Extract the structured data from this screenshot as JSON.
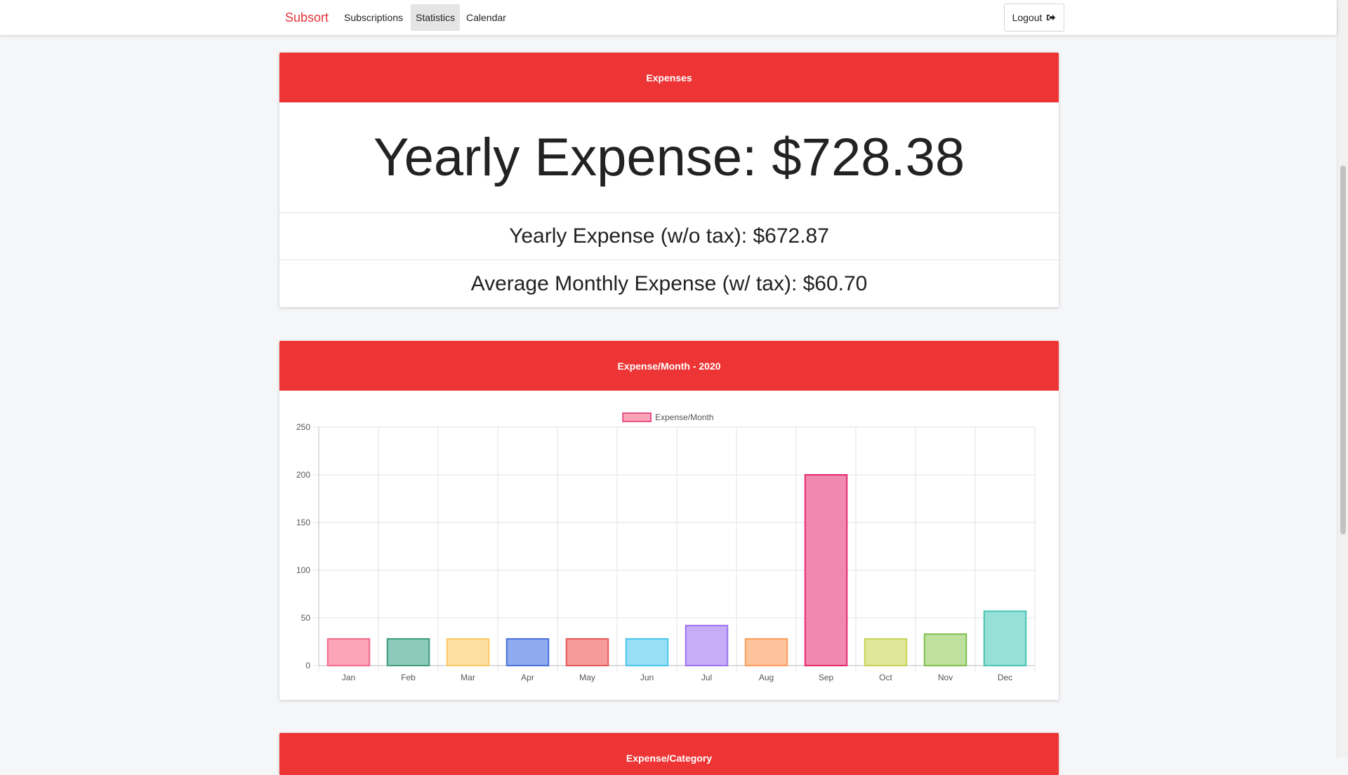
{
  "navbar": {
    "brand": "Subsort",
    "items": [
      {
        "label": "Subscriptions",
        "active": false
      },
      {
        "label": "Statistics",
        "active": true
      },
      {
        "label": "Calendar",
        "active": false
      }
    ],
    "logout_label": "Logout",
    "logout_icon": "sign-out-icon"
  },
  "expenses_card": {
    "header": "Expenses",
    "yearly": "Yearly Expense: $728.38",
    "yearly_no_tax": "Yearly Expense (w/o tax): $672.87",
    "avg_monthly": "Average Monthly Expense (w/ tax): $60.70"
  },
  "chart_card": {
    "header": "Expense/Month - 2020"
  },
  "category_card": {
    "header": "Expense/Category"
  },
  "colors": {
    "accent": "#ee3535",
    "brand": "#e9353a"
  },
  "chart_data": {
    "type": "bar",
    "categories": [
      "Jan",
      "Feb",
      "Mar",
      "Apr",
      "May",
      "Jun",
      "Jul",
      "Aug",
      "Sep",
      "Oct",
      "Nov",
      "Dec"
    ],
    "series": [
      {
        "name": "Expense/Month",
        "values": [
          28,
          28,
          28,
          28,
          28,
          28,
          42,
          28,
          200,
          28,
          33,
          57
        ]
      }
    ],
    "ylim": [
      0,
      250
    ],
    "yticks": [
      0,
      50,
      100,
      150,
      200,
      250
    ],
    "grid": true,
    "legend": "top-center",
    "bar_fills": [
      "#fda4b8",
      "#8ecaba",
      "#fddfa2",
      "#8fabf0",
      "#f69a9a",
      "#96dff5",
      "#c5adf8",
      "#fdc49c",
      "#f189ae",
      "#e1e799",
      "#bee19f",
      "#97e0d8"
    ],
    "bar_strokes": [
      "#f2698a",
      "#3e9a7d",
      "#fcc964",
      "#4870d8",
      "#e45a5a",
      "#49c6ec",
      "#9a74ef",
      "#fb9d5c",
      "#e4286f",
      "#c6d25b",
      "#7fbf4b",
      "#49c3b5"
    ],
    "legend_fill": "#fda4b8",
    "legend_stroke": "#e4286f"
  }
}
